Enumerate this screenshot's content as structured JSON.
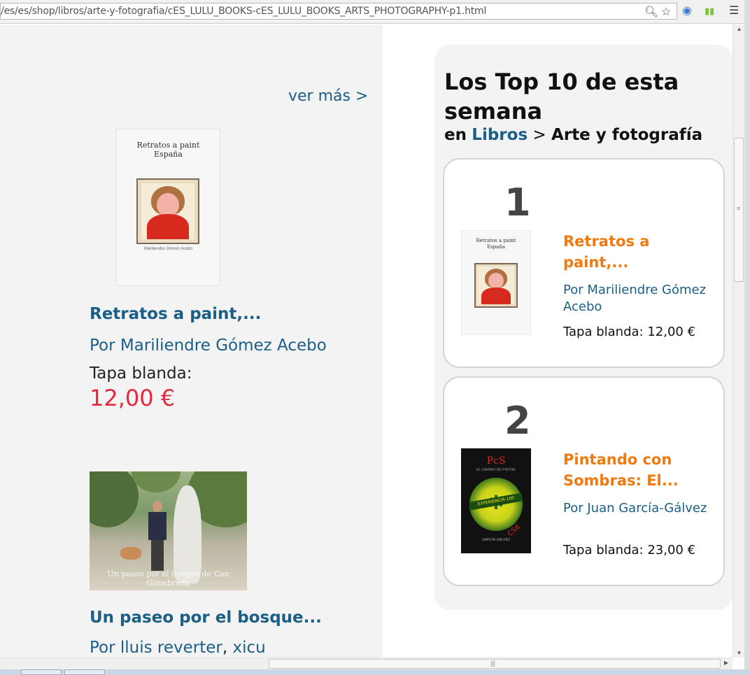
{
  "browser": {
    "url": "/es/es/shop/libros/arte-y-fotografia/cES_LULU_BOOKS-cES_LULU_BOOKS_ARTS_PHOTOGRAPHY-p1.html",
    "icons": [
      "zoom-icon",
      "star-icon",
      "extension-icon",
      "signal-icon",
      "menu-icon"
    ]
  },
  "left": {
    "ver_mas": "ver más >",
    "products": [
      {
        "cover_title": "Retratos a paint\nEspaña",
        "title": "Retratos a paint,...",
        "author_prefix": "Por",
        "author": "Mariliendre Gómez Acebo",
        "format": "Tapa blanda:",
        "price": "12,00 €"
      },
      {
        "cover_caption": "Un paseo por el bosque de Can Gimebrada",
        "title": "Un paseo por el bosque...",
        "author_prefix": "Por",
        "author": "lluis reverter",
        "author_sep": ",",
        "author2": "xicu"
      }
    ]
  },
  "top10": {
    "title": "Los Top 10 de esta semana",
    "sub_en": "en",
    "sub_category": "Libros",
    "sub_sep": ">",
    "sub_subcategory": "Arte y fotografía",
    "items": [
      {
        "rank": "1",
        "title": "Retratos a paint,...",
        "author": "Por Mariliendre Gómez Acebo",
        "price": "Tapa blanda: 12,00 €",
        "cover_title": "Retratos a paint\nEspaña"
      },
      {
        "rank": "2",
        "title": "Pintando con Sombras: El...",
        "author": "Por Juan García-Gálvez",
        "price": "Tapa blanda: 23,00 €",
        "cover_title": "PcS",
        "cover_badge": "EXPERIENCIA 100",
        "cover_edition": "CS6"
      }
    ]
  }
}
